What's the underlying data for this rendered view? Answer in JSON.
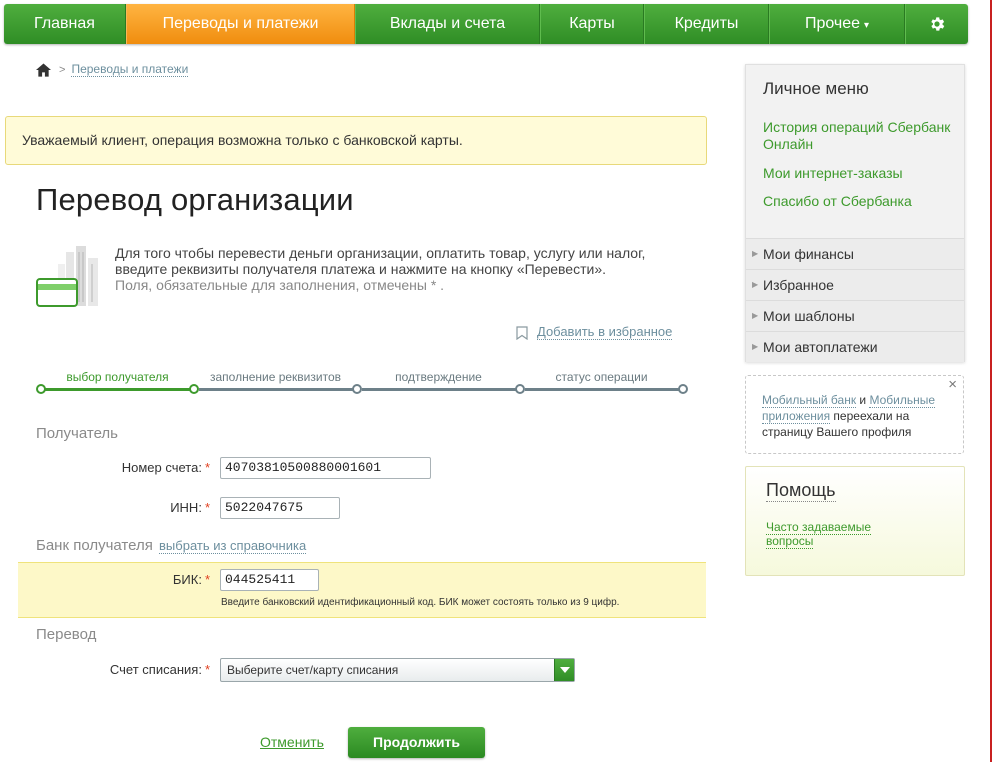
{
  "nav": {
    "items": [
      {
        "label": "Главная"
      },
      {
        "label": "Переводы и платежи"
      },
      {
        "label": "Вклады и счета"
      },
      {
        "label": "Карты"
      },
      {
        "label": "Кредиты"
      },
      {
        "label": "Прочее"
      }
    ],
    "other_caret": "▾",
    "active_index": 1
  },
  "breadcrumb": {
    "link": "Переводы и платежи"
  },
  "warning": {
    "text": "Уважаемый клиент, операция возможна только с банковской карты."
  },
  "page": {
    "title": "Перевод организации",
    "intro": "Для того чтобы перевести деньги организации, оплатить товар, услугу или налог, введите реквизиты получателя платежа и нажмите на кнопку «Перевести».",
    "required_note": "Поля, обязательные для заполнения, отмечены * ."
  },
  "favorite": {
    "label": "Добавить в избранное"
  },
  "steps": [
    {
      "label": "выбор получателя",
      "done": true
    },
    {
      "label": "заполнение реквизитов",
      "done": false
    },
    {
      "label": "подтверждение",
      "done": false
    },
    {
      "label": "статус операции",
      "done": false
    }
  ],
  "form": {
    "recipient_section": "Получатель",
    "account_label": "Номер счета:",
    "account_value": "40703810500880001601",
    "inn_label": "ИНН:",
    "inn_value": "5022047675",
    "bank_section": "Банк получателя",
    "bank_pick_link": "выбрать из справочника",
    "bik_label": "БИК:",
    "bik_value": "044525411",
    "bik_hint": "Введите банковский идентификационный код. БИК может состоять только из 9 цифр.",
    "transfer_section": "Перевод",
    "debit_label": "Счет списания:",
    "debit_placeholder": "Выберите счет/карту списания",
    "required_mark": "*"
  },
  "actions": {
    "cancel": "Отменить",
    "continue": "Продолжить"
  },
  "sidebar": {
    "title": "Личное меню",
    "links": [
      "История операций Сбербанк Онлайн",
      "Мои интернет-заказы",
      "Спасибо от Сбербанка"
    ],
    "items": [
      "Мои финансы",
      "Избранное",
      "Мои шаблоны",
      "Мои автоплатежи"
    ],
    "notice": {
      "link1": "Мобильный банк",
      "and": " и ",
      "link2": "Мобильные приложения",
      "rest": " переехали на страницу Вашего профиля",
      "close": "×"
    },
    "help": {
      "title": "Помощь",
      "link": "Часто задаваемые вопросы"
    }
  },
  "colors": {
    "brand_green": "#3d9a2c",
    "active_orange": "#f5a020",
    "warning_bg": "#fffbd8"
  }
}
